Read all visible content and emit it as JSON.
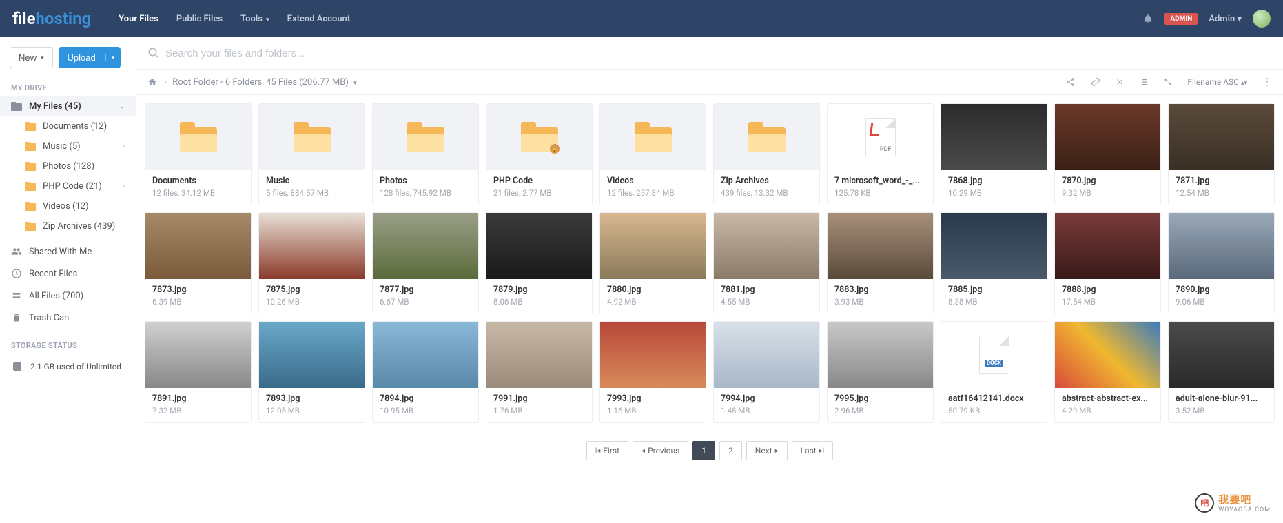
{
  "brand": {
    "left": "file",
    "right": "hosting"
  },
  "nav": {
    "your_files": "Your Files",
    "public_files": "Public Files",
    "tools": "Tools",
    "extend": "Extend Account"
  },
  "header": {
    "admin_badge": "ADMIN",
    "user_label": "Admin"
  },
  "sidebar": {
    "new_label": "New",
    "upload_label": "Upload",
    "my_drive_head": "MY DRIVE",
    "my_files": "My Files (45)",
    "tree": [
      {
        "label": "Documents (12)"
      },
      {
        "label": "Music (5)",
        "chev": true
      },
      {
        "label": "Photos (128)"
      },
      {
        "label": "PHP Code (21)",
        "chev": true
      },
      {
        "label": "Videos (12)"
      },
      {
        "label": "Zip Archives (439)"
      }
    ],
    "misc": {
      "shared": "Shared With Me",
      "recent": "Recent Files",
      "all": "All Files (700)",
      "trash": "Trash Can"
    },
    "storage_head": "STORAGE STATUS",
    "storage_text": "2.1 GB used of Unlimited"
  },
  "search": {
    "placeholder": "Search your files and folders..."
  },
  "breadcrumb": {
    "text": "Root Folder - 6 Folders, 45 Files (206.77 MB)",
    "sort": "Filename ASC"
  },
  "items": [
    {
      "kind": "folder",
      "title": "Documents",
      "sub": "12 files, 34.12 MB"
    },
    {
      "kind": "folder",
      "title": "Music",
      "sub": "5 files, 884.57 MB"
    },
    {
      "kind": "folder",
      "title": "Photos",
      "sub": "128 files, 745.92 MB"
    },
    {
      "kind": "folder",
      "locked": true,
      "title": "PHP Code",
      "sub": "21 files, 2.77 MB"
    },
    {
      "kind": "folder",
      "title": "Videos",
      "sub": "12 files, 257.84 MB"
    },
    {
      "kind": "folder",
      "title": "Zip Archives",
      "sub": "439 files, 13.32 MB"
    },
    {
      "kind": "pdf",
      "title": "7 microsoft_word_-_...",
      "sub": "125.78 KB"
    },
    {
      "kind": "image",
      "bg": "linear-gradient(#2b2b2b,#4a4a4a)",
      "title": "7868.jpg",
      "sub": "10.29 MB"
    },
    {
      "kind": "image",
      "bg": "linear-gradient(#6b3a2a,#3a1f15)",
      "title": "7870.jpg",
      "sub": "9.32 MB"
    },
    {
      "kind": "image",
      "bg": "linear-gradient(#5a4a3a,#3a2f25)",
      "title": "7871.jpg",
      "sub": "12.54 MB"
    },
    {
      "kind": "image",
      "bg": "linear-gradient(#a68a6a,#7a5a3a)",
      "title": "7873.jpg",
      "sub": "6.39 MB"
    },
    {
      "kind": "image",
      "bg": "linear-gradient(#e8e0d5,#8a3a2a)",
      "title": "7875.jpg",
      "sub": "10.26 MB"
    },
    {
      "kind": "image",
      "bg": "linear-gradient(#9aa088,#5a6a3a)",
      "title": "7877.jpg",
      "sub": "6.67 MB"
    },
    {
      "kind": "image",
      "bg": "linear-gradient(#3a3a3a,#1a1a1a)",
      "title": "7879.jpg",
      "sub": "8.06 MB"
    },
    {
      "kind": "image",
      "bg": "linear-gradient(#d8b890,#8a7a5a)",
      "title": "7880.jpg",
      "sub": "4.92 MB"
    },
    {
      "kind": "image",
      "bg": "linear-gradient(#c8b8a8,#8a7a6a)",
      "title": "7881.jpg",
      "sub": "4.55 MB"
    },
    {
      "kind": "image",
      "bg": "linear-gradient(#a8907a,#5a4a3a)",
      "title": "7883.jpg",
      "sub": "3.93 MB"
    },
    {
      "kind": "image",
      "bg": "linear-gradient(#2a3a4a,#4a5a6a)",
      "title": "7885.jpg",
      "sub": "8.38 MB"
    },
    {
      "kind": "image",
      "bg": "linear-gradient(#7a3a3a,#3a1a1a)",
      "title": "7888.jpg",
      "sub": "17.54 MB"
    },
    {
      "kind": "image",
      "bg": "linear-gradient(#9aa8b8,#5a6a7a)",
      "title": "7890.jpg",
      "sub": "9.06 MB"
    },
    {
      "kind": "image",
      "bg": "linear-gradient(#d0d0d0,#888888)",
      "title": "7891.jpg",
      "sub": "7.32 MB"
    },
    {
      "kind": "image",
      "bg": "linear-gradient(#6aa8c8,#3a6a8a)",
      "title": "7893.jpg",
      "sub": "12.05 MB"
    },
    {
      "kind": "image",
      "bg": "linear-gradient(#8ab8d8,#5a88a8)",
      "title": "7894.jpg",
      "sub": "10.95 MB"
    },
    {
      "kind": "image",
      "bg": "linear-gradient(#c8b8a8,#9a8a7a)",
      "title": "7991.jpg",
      "sub": "1.76 MB"
    },
    {
      "kind": "image",
      "bg": "linear-gradient(#b8483a,#d88a5a)",
      "title": "7993.jpg",
      "sub": "1.16 MB"
    },
    {
      "kind": "image",
      "bg": "linear-gradient(#d8e0e8,#a8b8c8)",
      "title": "7994.jpg",
      "sub": "1.48 MB"
    },
    {
      "kind": "image",
      "bg": "linear-gradient(#c8c8c8,#888888)",
      "title": "7995.jpg",
      "sub": "2.96 MB"
    },
    {
      "kind": "docx",
      "title": "aatf16412141.docx",
      "sub": "50.79 KB"
    },
    {
      "kind": "image",
      "bg": "linear-gradient(45deg,#d84a3a,#f0b830,#3a7bbf)",
      "title": "abstract-abstract-ex...",
      "sub": "4.29 MB"
    },
    {
      "kind": "image",
      "bg": "linear-gradient(#4a4a4a,#2a2a2a)",
      "title": "adult-alone-blur-91...",
      "sub": "3.52 MB"
    }
  ],
  "docx_label": "DOCX",
  "pdf_label": "PDF",
  "pager": {
    "first": "First",
    "prev": "Previous",
    "p1": "1",
    "p2": "2",
    "next": "Next",
    "last": "Last"
  },
  "watermark": {
    "brand": "我要吧",
    "domain": "WOYAOBA.COM"
  }
}
